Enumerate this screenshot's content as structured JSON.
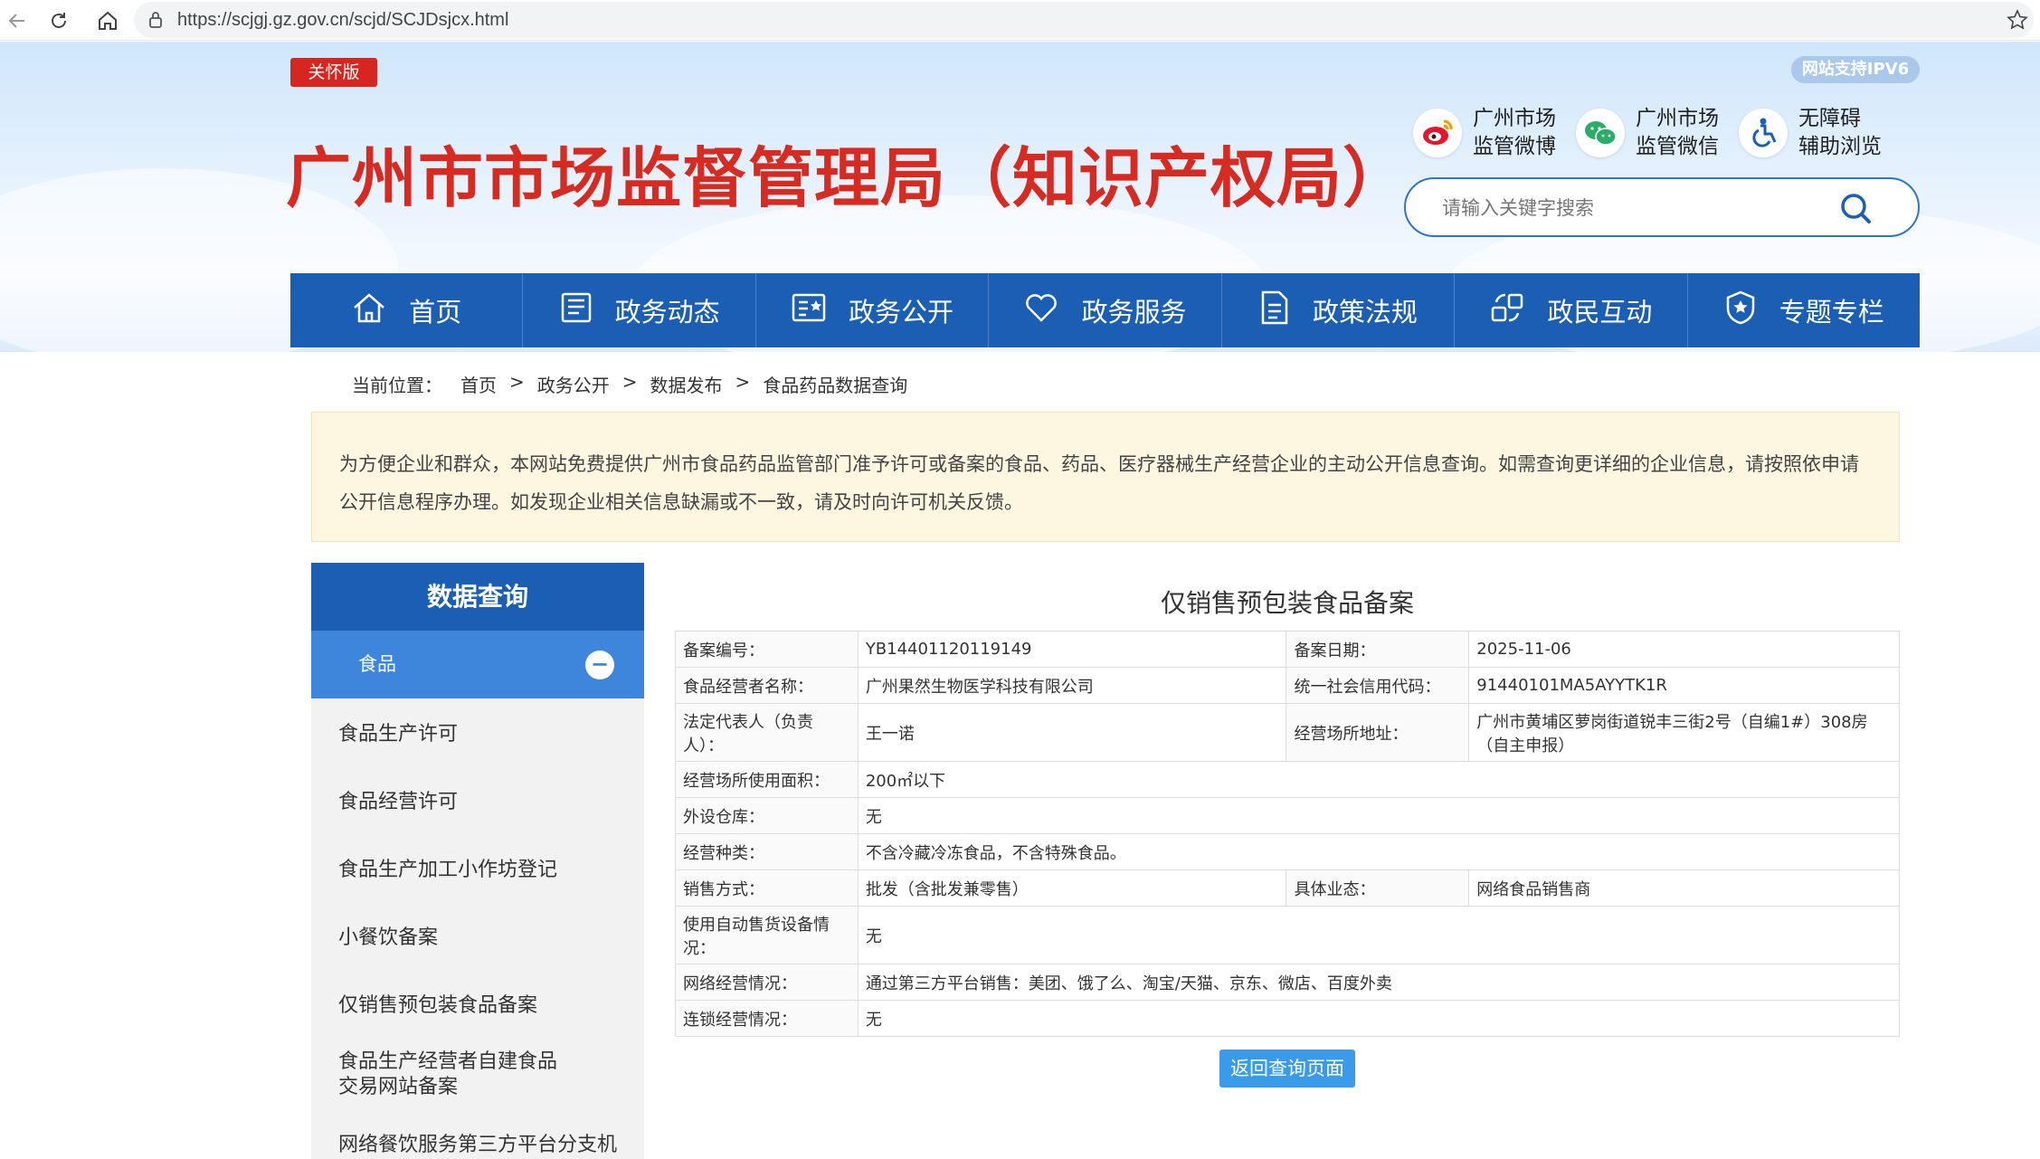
{
  "browser": {
    "url": "https://scjgj.gz.gov.cn/scjd/SCJDsjcx.html"
  },
  "header": {
    "care_label": "关怀版",
    "site_title": "广州市市场监督管理局（知识产权局）",
    "ipv6_label": "网站支持IPV6",
    "quick_links": [
      {
        "icon": "weibo-icon",
        "line1": "广州市场",
        "line2": "监管微博"
      },
      {
        "icon": "wechat-icon",
        "line1": "广州市场",
        "line2": "监管微信"
      },
      {
        "icon": "accessibility-icon",
        "line1": "无障碍",
        "line2": "辅助浏览"
      }
    ],
    "search_placeholder": "请输入关键字搜索"
  },
  "nav": {
    "items": [
      {
        "label": "首页",
        "icon": "home-icon"
      },
      {
        "label": "政务动态",
        "icon": "news-icon"
      },
      {
        "label": "政务公开",
        "icon": "open-gov-icon"
      },
      {
        "label": "政务服务",
        "icon": "heart-icon"
      },
      {
        "label": "政策法规",
        "icon": "document-icon"
      },
      {
        "label": "政民互动",
        "icon": "interaction-icon"
      },
      {
        "label": "专题专栏",
        "icon": "special-topic-icon"
      }
    ]
  },
  "breadcrumb": {
    "prefix": "当前位置：",
    "items": [
      "首页",
      ">",
      "政务公开",
      ">",
      "数据发布",
      ">",
      "食品药品数据查询"
    ]
  },
  "notice": {
    "text": "为方便企业和群众，本网站免费提供广州市食品药品监管部门准予许可或备案的食品、药品、医疗器械生产经营企业的主动公开信息查询。如需查询更详细的企业信息，请按照依申请公开信息程序办理。如发现企业相关信息缺漏或不一致，请及时向许可机关反馈。"
  },
  "sidebar": {
    "title": "数据查询",
    "active": "食品",
    "active_toggle": "−",
    "items": [
      "食品生产许可",
      "食品经营许可",
      "食品生产加工小作坊登记",
      "小餐饮备案",
      "仅销售预包装食品备案",
      "食品生产经营者自建食品交易网站备案",
      "网络餐饮服务第三方平台分支机"
    ]
  },
  "record": {
    "title": "仅销售预包装食品备案",
    "rows": [
      {
        "k1": "备案编号：",
        "v1": "YB14401120119149",
        "k2": "备案日期：",
        "v2": "2025-11-06"
      },
      {
        "k1": "食品经营者名称：",
        "v1": "广州果然生物医学科技有限公司",
        "k2": "统一社会信用代码：",
        "v2": "91440101MA5AYYTK1R"
      },
      {
        "k1": "法定代表人（负责人）：",
        "v1": "王一诺",
        "k2": "经营场所地址：",
        "v2": "广州市黄埔区萝岗街道锐丰三街2号（自编1#）308房（自主申报）"
      },
      {
        "k1": "经营场所使用面积：",
        "v1": "200㎡以下"
      },
      {
        "k1": "外设仓库：",
        "v1": "无"
      },
      {
        "k1": "经营种类：",
        "v1": "不含冷藏冷冻食品，不含特殊食品。"
      },
      {
        "k1": "销售方式：",
        "v1": "批发（含批发兼零售）",
        "k2": "具体业态：",
        "v2": "网络食品销售商"
      },
      {
        "k1": "使用自动售货设备情况：",
        "v1": "无"
      },
      {
        "k1": "网络经营情况：",
        "v1": "通过第三方平台销售：美团、饿了么、淘宝/天猫、京东、微店、百度外卖"
      },
      {
        "k1": "连锁经营情况：",
        "v1": "无"
      }
    ],
    "back_button": "返回查询页面"
  }
}
